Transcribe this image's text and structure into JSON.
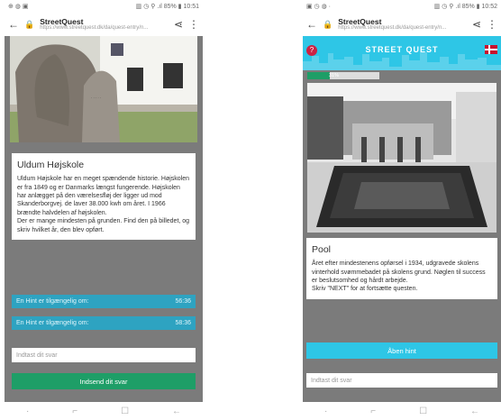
{
  "left": {
    "status": {
      "left": "⊕ ◍ ▣",
      "right": "▥ ◷ ⚲ .ıl 85% ▮ 10:51"
    },
    "browser": {
      "site_title": "StreetQuest",
      "site_url": "https://www.streetquest.dk/da/quest-entry/n..."
    },
    "card": {
      "title": "Uldum Højskole",
      "body": "Uldum Højskole har en meget spændende historie. Højskolen er fra 1849 og er Danmarks længst fungerende. Højskolen har anlægget på den værelsesfløj der ligger ud mod Skanderborgvej. de laver 38.000 kwh om året. I 1966 brændte halvdelen af højskolen.",
      "body2": "Der er mange mindesten på grunden. Find den på billedet, og skriv hvilket år, den blev opført."
    },
    "hints": [
      {
        "label": "En Hint er tilgængelig om:",
        "time": "56:36"
      },
      {
        "label": "En Hint er tilgængelig om:",
        "time": "58:36"
      }
    ],
    "answer_placeholder": "Indtast dit svar",
    "submit_label": "Indsend dit svar"
  },
  "right": {
    "status": {
      "left": "▣ ◷ ◍ ·",
      "right": "▥ ◷ ⚲ .ıl 85% ▮ 10:52"
    },
    "browser": {
      "site_title": "StreetQuest",
      "site_url": "https://www.streetquest.dk/da/quest-entry/n..."
    },
    "header_title": "STREET QUEST",
    "help_icon": "?",
    "progress": {
      "label": "31%",
      "fraction": 0.31
    },
    "card": {
      "title": "Pool",
      "body": "Året efter mindestenens opførsel i 1934, udgravede skolens vinterhold svømmebadet på skolens grund. Nøglen til success er beslutsomhed og hårdt arbejde.",
      "body2": "Skriv \"NEXT\" for at fortsætte questen."
    },
    "open_label": "Åben hint",
    "answer_placeholder": "Indtast dit svar"
  },
  "icons": {
    "back": "←",
    "share": "⋖",
    "menu": "⋮",
    "lock": "🔒",
    "nav_recent": "⌐",
    "nav_home": "☐",
    "nav_back": "←"
  },
  "colors": {
    "accent": "#2ec6e6",
    "hint": "#2ea3c1",
    "submit": "#1e9e67"
  }
}
